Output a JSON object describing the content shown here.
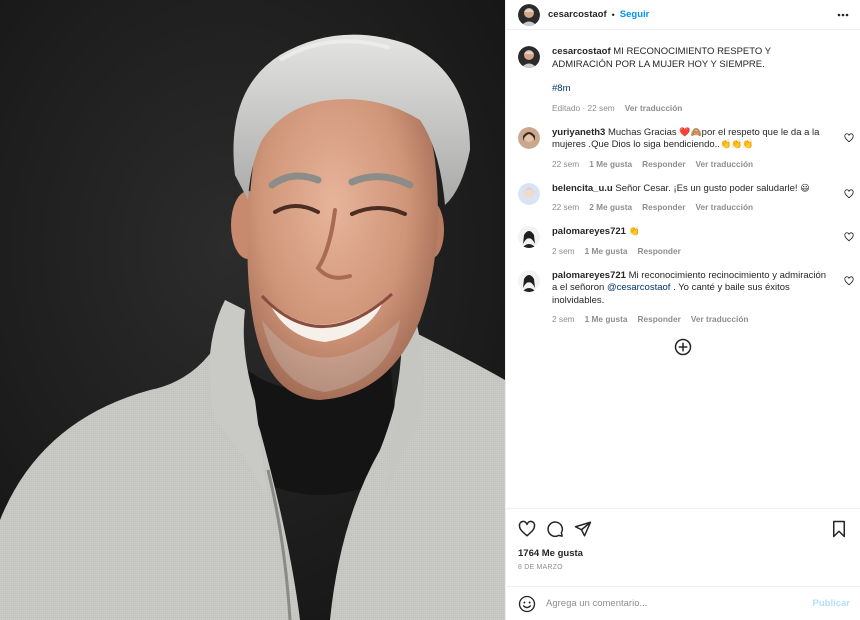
{
  "post": {
    "author": "cesarcostaof",
    "follow_label": "Seguir",
    "separator": "•",
    "caption": {
      "username": "cesarcostaof",
      "text": "MI RECONOCIMIENTO RESPETO Y ADMIRACIÓN POR LA MUJER HOY Y SIEMPRE.",
      "hashtag": "#8m",
      "edited": "Editado · 22 sem",
      "translate": "Ver traducción"
    }
  },
  "comments": [
    {
      "username": "yuriyaneth3",
      "text_a": "Muchas Gracias ",
      "emoji_a": "❤️🙈",
      "text_b": "por el respeto que le da a la mujeres .Que Dios lo siga bendiciendo..",
      "emoji_b": "👏👏👏",
      "time": "22 sem",
      "likes": "1 Me gusta",
      "reply": "Responder",
      "translate": "Ver traducción"
    },
    {
      "username": "belencita_u.u",
      "text_a": "Señor Cesar. ¡Es un gusto poder saludarle! ",
      "emoji_a": "😃",
      "time": "22 sem",
      "likes": "2 Me gusta",
      "reply": "Responder",
      "translate": "Ver traducción"
    },
    {
      "username": "palomareyes721",
      "emoji_a": "👏",
      "time": "2 sem",
      "likes": "1 Me gusta",
      "reply": "Responder"
    },
    {
      "username": "palomareyes721",
      "text_a": "Mi reconocimiento recinocimiento y admiración a el señoron ",
      "mention": "@cesarcostaof",
      "text_b": " . Yo canté y baile sus éxitos inolvidables.",
      "time": "2 sem",
      "likes": "1 Me gusta",
      "reply": "Responder",
      "translate": "Ver traducción"
    }
  ],
  "footer": {
    "likes": "1764 Me gusta",
    "date": "8 DE MARZO",
    "comment_placeholder": "Agrega un comentario...",
    "publish": "Publicar"
  },
  "icons": {
    "more": "more-horizontal-icon",
    "heart": "heart-outline-icon",
    "add": "plus-circle-icon",
    "comment": "comment-bubble-icon",
    "share": "paper-plane-icon",
    "save": "bookmark-icon",
    "emoji": "smiley-icon"
  },
  "colors": {
    "accent": "#0095f6",
    "link": "#00376b",
    "muted": "#8e8e8e",
    "publish_disabled": "#b2dffc",
    "photo_background": "#1f1f1f"
  }
}
